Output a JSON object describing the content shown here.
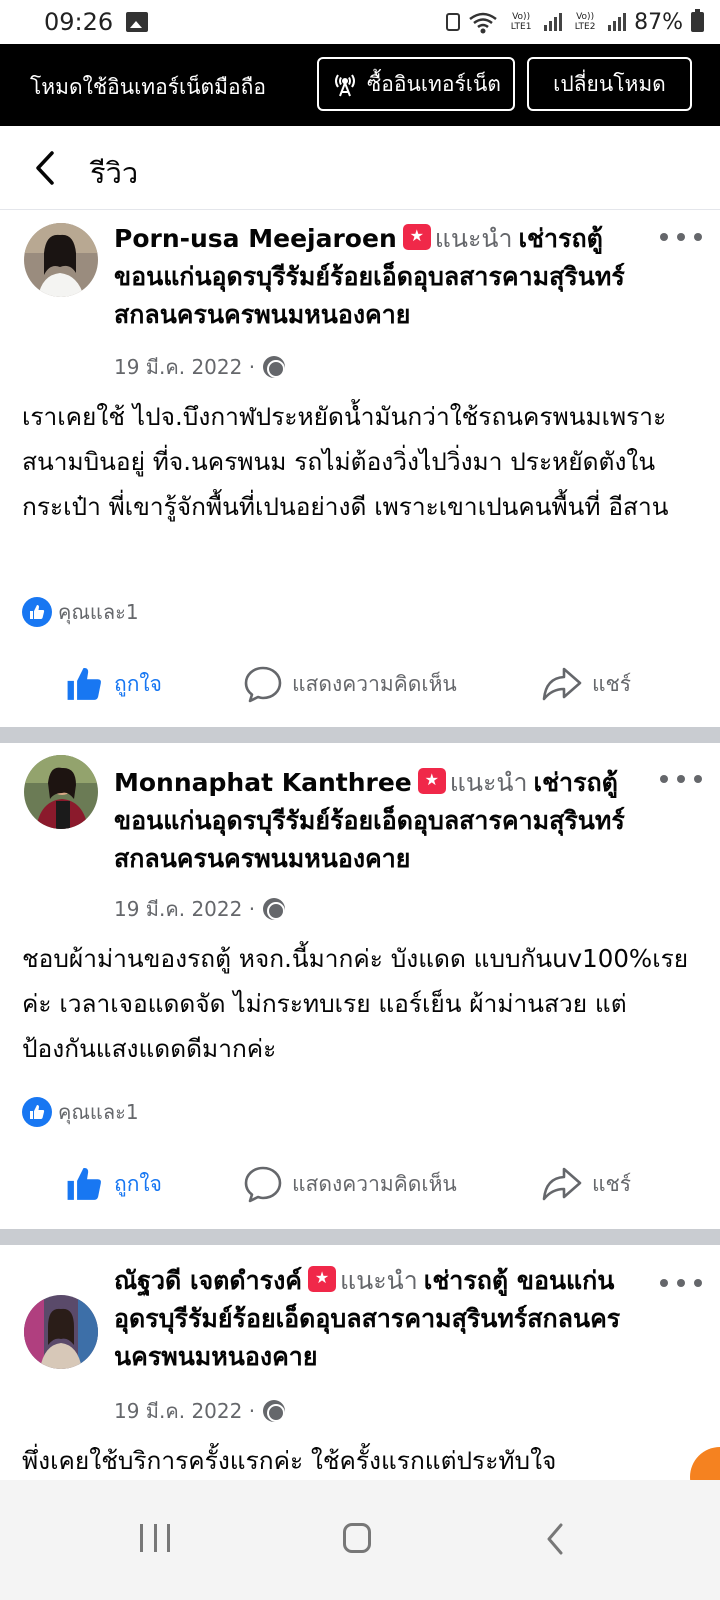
{
  "status_bar": {
    "time": "09:26",
    "sim1": "Vo)) LTE1",
    "sim2": "Vo)) LTE2",
    "battery": "87%"
  },
  "mode_banner": {
    "label": "โหมดใช้อินเทอร์เน็ตมือถือ",
    "buy_button": "ซื้ออินเทอร์เน็ต",
    "switch_button": "เปลี่ยนโหมด"
  },
  "header": {
    "title": "รีวิว"
  },
  "reviews": [
    {
      "name": "Porn-usa Meejaroen",
      "recommends_label": "แนะนำ",
      "page_name": "เช่ารถตู้ ขอนแก่นอุดรบุรีรัมย์ร้อยเอ็ดอุบลสารคามสุรินทร์สกลนครนครพนมหนองคาย",
      "date": "19 มี.ค. 2022 ·",
      "text": "เราเคยใช้ ไปจ.บึงกาฬประหยัดน้ำมันกว่าใช้รถนครพนมเพราะสนามบินอยู่ ที่จ.นครพนม รถไม่ต้องวิ่งไปวิ่งมา ประหยัดตังในกระเป๋า พี่เขารู้จักพื้นที่เปนอย่างดี เพราะเขาเปนคนพื้นที่ อีสาน",
      "reactions": "คุณและ1",
      "like_label": "ถูกใจ",
      "comment_label": "แสดงความคิดเห็น",
      "share_label": "แชร์"
    },
    {
      "name": "Monnaphat Kanthree",
      "recommends_label": "แนะนำ",
      "page_name": "เช่ารถตู้ ขอนแก่นอุดรบุรีรัมย์ร้อยเอ็ดอุบลสารคามสุรินทร์สกลนครนครพนมหนองคาย",
      "date": "19 มี.ค. 2022 ·",
      "text": "ชอบผ้าม่านของรถตู้ หจก.นี้มากค่ะ บังแดด แบบกันuv100%เรยค่ะ เวลาเจอแดดจัด ไม่กระทบเรย แอร์เย็น ผ้าม่านสวย แต่ป้องกันแสงแดดดีมากค่ะ",
      "reactions": "คุณและ1",
      "like_label": "ถูกใจ",
      "comment_label": "แสดงความคิดเห็น",
      "share_label": "แชร์"
    },
    {
      "name": "ณัฐวดี เจตดำรงค์",
      "recommends_label": "แนะนำ",
      "page_name": "เช่ารถตู้ ขอนแก่นอุดรบุรีรัมย์ร้อยเอ็ดอุบลสารคามสุรินทร์สกลนครนครพนมหนองคาย",
      "date": "19 มี.ค. 2022 ·",
      "text": "พึ่งเคยใช้บริการครั้งแรกค่ะ  ใช้ครั้งแรกแต่ประทับใจ"
    }
  ],
  "colors": {
    "facebook_blue": "#1877f2",
    "secondary_text": "#65676b",
    "recommend_red": "#f02849",
    "separator": "#c9ccd1"
  },
  "icons": {
    "back": "chevron-left-icon",
    "more": "more-horizontal-icon",
    "audience": "globe-icon",
    "like": "thumbs-up-icon",
    "comment": "comment-bubble-icon",
    "share": "share-arrow-icon",
    "broadcast": "broadcast-icon"
  }
}
